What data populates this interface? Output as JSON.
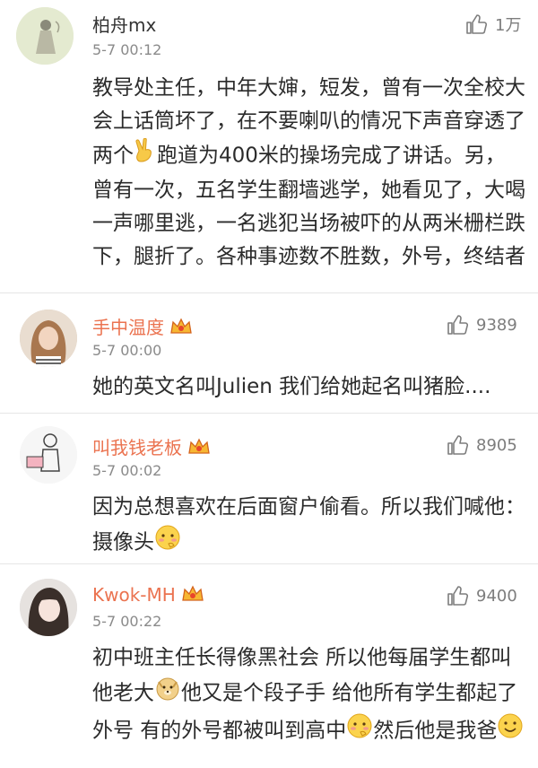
{
  "comments": [
    {
      "username": "柏舟mx",
      "time": "5-7 00:12",
      "likes": "1万",
      "text_segments": [
        "教导处主任，中年大婶，短发，曾有一次全校大会上话筒坏了，在不要喇叭的情况下声音穿透了两个",
        "跑道为400米的操场完成了讲话。另，曾有一次，五名学生翻墙逃学，她看见了，大喝一声哪里逃，一名逃犯当场被吓的从两米栅栏跌下，腿折了。各种事迹数不胜数，外号，终结者"
      ],
      "emoji": [
        "victory-hand"
      ],
      "vip": false,
      "name_color": "#333333"
    },
    {
      "username": "手中温度",
      "time": "5-7 00:00",
      "likes": "9389",
      "text_segments": [
        "她的英文名叫Julien 我们给她起名叫猪脸...."
      ],
      "vip": true,
      "name_color": "#eb7350"
    },
    {
      "username": "叫我钱老板",
      "time": "5-7 00:02",
      "likes": "8905",
      "text_segments": [
        "因为总想喜欢在后面窗户偷看。所以我们喊他：摄像头"
      ],
      "emoji": [
        "shy-face"
      ],
      "vip": true,
      "name_color": "#eb7350"
    },
    {
      "username": "Kwok-MH",
      "time": "5-7 00:22",
      "likes": "9400",
      "text_segments": [
        "初中班主任长得像黑社会 所以他每届学生都叫他老大",
        "他又是个段子手 给他所有学生都起了外号 有的外号都被叫到高中",
        "然后他是我爸",
        ""
      ],
      "emoji": [
        "doge",
        "shy-face",
        "smile"
      ],
      "vip": true,
      "name_color": "#eb7350"
    }
  ]
}
